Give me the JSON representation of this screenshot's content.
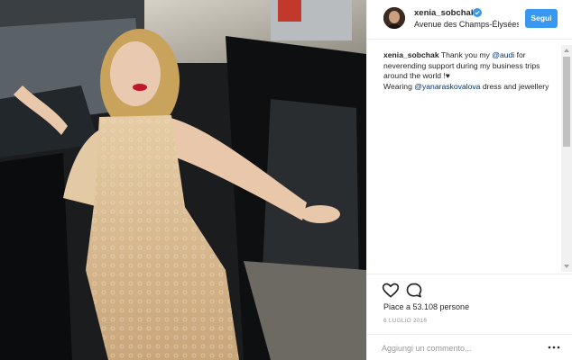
{
  "header": {
    "username": "xenia_sobchak",
    "location": "Avenue des Champs-Élysées",
    "follow_label": "Segui"
  },
  "caption": {
    "username": "xenia_sobchak",
    "text_1": " Thank you my ",
    "mention_1": "@audi",
    "text_2": " for neverending support during my business trips around the world !",
    "emoji": "♥",
    "text_3": " Wearing ",
    "mention_2": "@yanaraskovalova",
    "text_4": " dress and jewellery"
  },
  "stats": {
    "likes": "Piace a 53.108 persone",
    "date": "6 LUGLIO 2016"
  },
  "comment": {
    "placeholder": "Aggiungi un commento..."
  },
  "icons": {
    "verified": "verified-badge-icon",
    "like": "heart-icon",
    "comment": "comment-bubble-icon",
    "more": "more-options-icon"
  },
  "colors": {
    "follow_button": "#3897f0",
    "mention": "#003569",
    "verified": "#3897f0"
  }
}
